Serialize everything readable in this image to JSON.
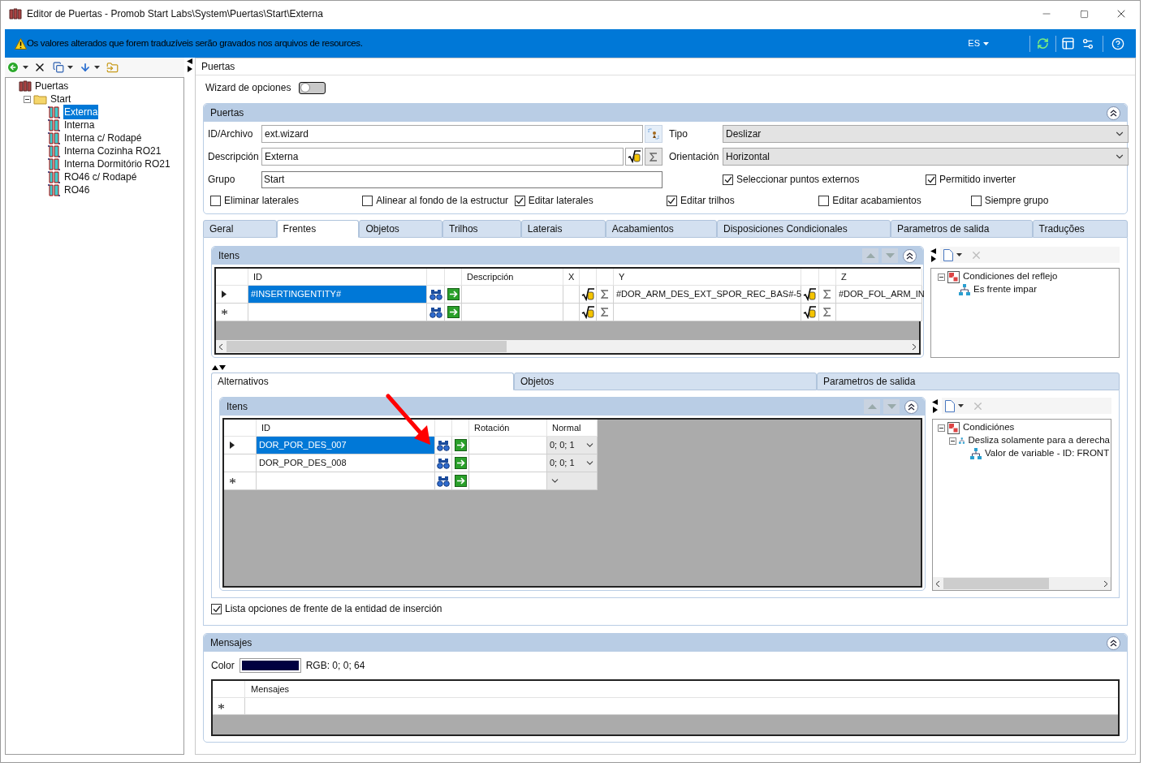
{
  "window": {
    "title": "Editor de Puertas - Promob Start Labs\\System\\Puertas\\Start\\Externa"
  },
  "banner": {
    "message": "Os valores alterados que forem traduzíveis serão gravados nos arquivos de resources.",
    "language": "ES"
  },
  "tree": [
    {
      "label": "Puertas",
      "kind": "root",
      "children": [
        {
          "label": "Start",
          "kind": "folder",
          "expanded": true,
          "children": [
            {
              "label": "Externa",
              "kind": "door",
              "selected": true
            },
            {
              "label": "Interna",
              "kind": "door",
              "selected": false
            },
            {
              "label": "Interna c/ Rodapé",
              "kind": "door",
              "selected": false
            },
            {
              "label": "Interna Cozinha RO21",
              "kind": "door",
              "selected": false
            },
            {
              "label": "Interna Dormitório RO21",
              "kind": "door",
              "selected": false
            },
            {
              "label": "RO46 c/ Rodapé",
              "kind": "door",
              "selected": false
            },
            {
              "label": "RO46",
              "kind": "door",
              "selected": false
            }
          ]
        }
      ]
    }
  ],
  "content_title": "Puertas",
  "wizard": {
    "label": "Wizard de opciones",
    "on": false
  },
  "puertas": {
    "title": "Puertas",
    "expanded": true,
    "id_archivo": {
      "label": "ID/Archivo",
      "value": "ext.wizard"
    },
    "descripcion": {
      "label": "Descripción",
      "value": "Externa"
    },
    "grupo": {
      "label": "Grupo",
      "value": "Start"
    },
    "tipo": {
      "label": "Tipo",
      "value": "Deslizar"
    },
    "orientacion": {
      "label": "Orientación",
      "value": "Horizontal"
    },
    "options_right": [
      {
        "label": "Seleccionar puntos externos",
        "checked": true
      },
      {
        "label": "Permitido inverter",
        "checked": true
      }
    ],
    "options": [
      {
        "label": "Eliminar laterales",
        "checked": false
      },
      {
        "label": "Alinear al fondo de la estructur",
        "checked": false
      },
      {
        "label": "Editar laterales",
        "checked": true
      },
      {
        "label": "Editar trilhos",
        "checked": true
      },
      {
        "label": "Editar acabamientos",
        "checked": false
      },
      {
        "label": "Siempre grupo",
        "checked": false
      }
    ]
  },
  "tabs": [
    {
      "label": "Geral",
      "selected": false
    },
    {
      "label": "Frentes",
      "selected": true
    },
    {
      "label": "Objetos",
      "selected": false
    },
    {
      "label": "Trilhos",
      "selected": false
    },
    {
      "label": "Laterais",
      "selected": false
    },
    {
      "label": "Acabamientos",
      "selected": false
    },
    {
      "label": "Disposiciones Condicionales",
      "selected": false
    },
    {
      "label": "Parametros de salida",
      "selected": false
    },
    {
      "label": "Traduções",
      "selected": false
    }
  ],
  "itens": {
    "title": "Itens",
    "expanded": true,
    "columns": {
      "id": "ID",
      "descripcion": "Descripción",
      "x": "X",
      "y": "Y",
      "z": "Z"
    },
    "rows": [
      {
        "kind": "current",
        "selected": true,
        "id": "#INSERTINGENTITY#",
        "y": "#DOR_ARM_DES_EXT_SPOR_REC_BAS#-5",
        "z": "#DOR_FOL_ARM_IN"
      },
      {
        "kind": "new",
        "selected": false
      }
    ]
  },
  "reflejo_tree": [
    {
      "label": "Condiciones del reflejo",
      "kind": "group",
      "expanded": true,
      "children": [
        {
          "label": "Es frente impar",
          "kind": "condition"
        }
      ]
    }
  ],
  "subtabs": [
    {
      "label": "Alternativos",
      "selected": true
    },
    {
      "label": "Objetos",
      "selected": false
    },
    {
      "label": "Parametros de salida",
      "selected": false
    }
  ],
  "alternativos": {
    "title": "Itens",
    "expanded": true,
    "columns": {
      "id": "ID",
      "rotacion": "Rotación",
      "normal": "Normal"
    },
    "rows": [
      {
        "kind": "current",
        "selected": true,
        "id": "DOR_POR_DES_007",
        "normal": "0; 0; 1"
      },
      {
        "kind": "plain",
        "selected": false,
        "id": "DOR_POR_DES_008",
        "normal": "0; 0; 1"
      },
      {
        "kind": "new",
        "selected": false
      }
    ]
  },
  "condiciones_tree": [
    {
      "label": "Condiciónes",
      "kind": "group",
      "expanded": true,
      "children": [
        {
          "label": "Desliza solamente para a derecha",
          "kind": "condition",
          "expanded": true,
          "children": [
            {
              "label": "Valor de variable - ID: FRONT",
              "kind": "condition"
            }
          ]
        }
      ]
    }
  ],
  "lista_opciones": {
    "label": "Lista opciones de frente de la entidad de inserción",
    "checked": true
  },
  "mensajes": {
    "title": "Mensajes",
    "expanded": true,
    "color_label": "Color",
    "color": "#000040",
    "rgb": "RGB: 0; 0; 64",
    "column": "Mensajes",
    "rows": [
      {
        "kind": "new"
      }
    ]
  }
}
